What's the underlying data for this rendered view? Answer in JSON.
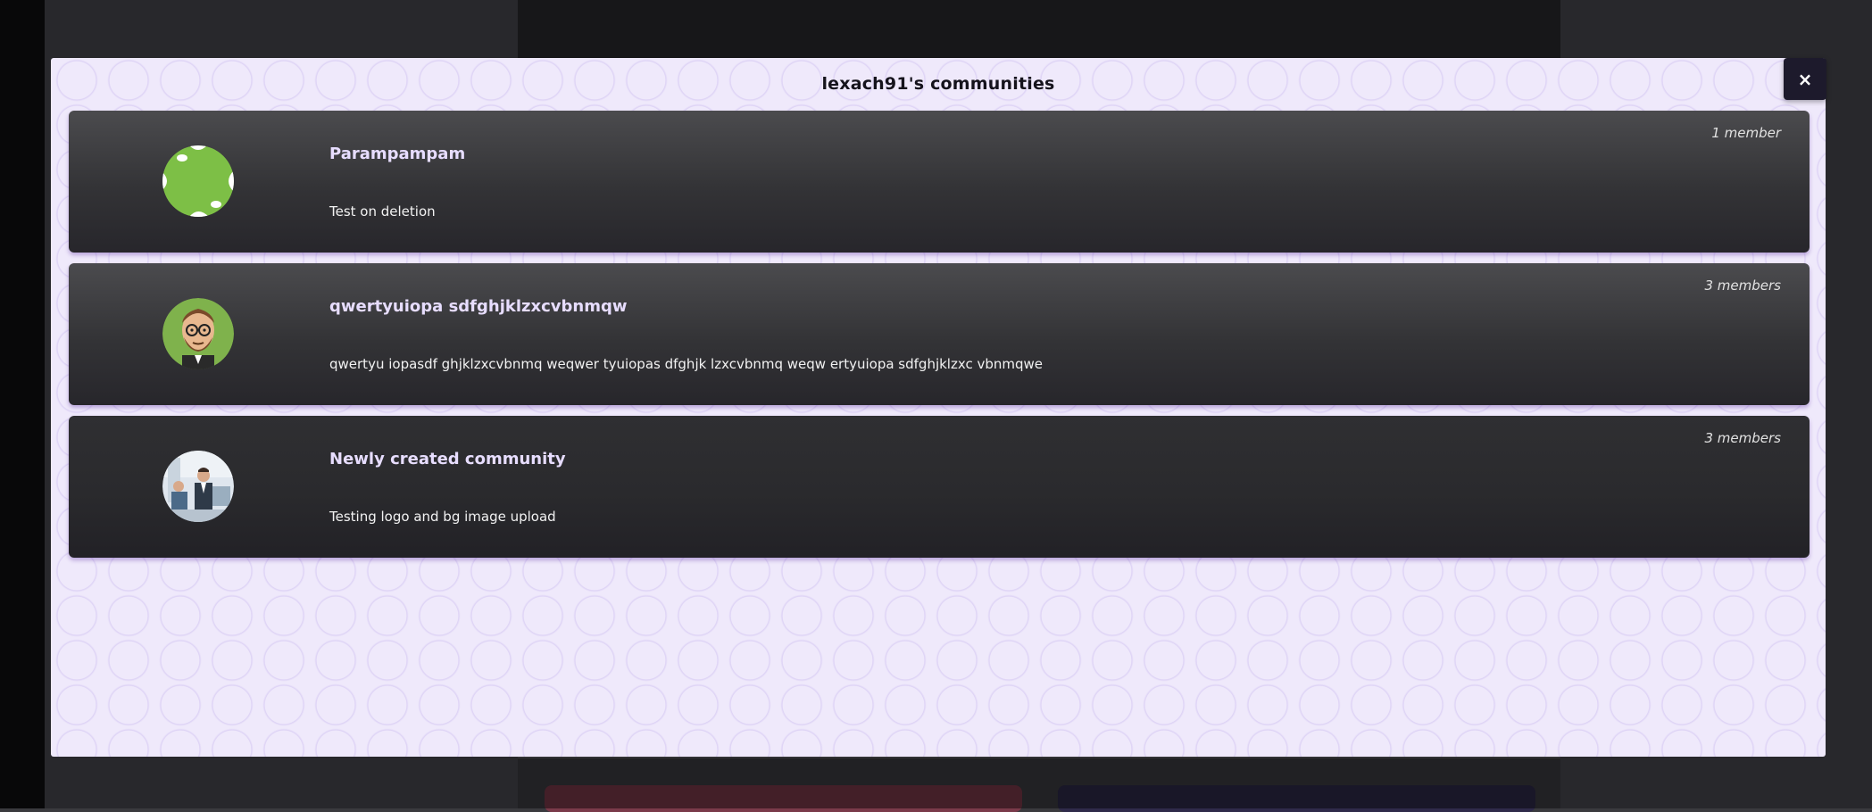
{
  "modal": {
    "title": "lexach91's communities",
    "close_label": "×"
  },
  "communities": [
    {
      "name": "Parampampam",
      "description": "Test on deletion",
      "members": "1 member",
      "logo": "green-blob-logo"
    },
    {
      "name": "qwertyuiopa sdfghjklzxcvbnmqw",
      "description": "qwertyu iopasdf ghjklzxcvbnmq weqwer tyuiopas dfghjk lzxcvbnmq weqw ertyuiopa sdfghjklzxc vbnmqwe",
      "members": "3 members",
      "logo": "bearded-man-avatar"
    },
    {
      "name": "Newly created community",
      "description": "Testing logo and bg image upload",
      "members": "3 members",
      "logo": "office-photo-logo"
    }
  ],
  "colors": {
    "modal_bg": "#efe9fb",
    "card_title": "#e7ddff",
    "close_button": "#1d1a2c"
  }
}
